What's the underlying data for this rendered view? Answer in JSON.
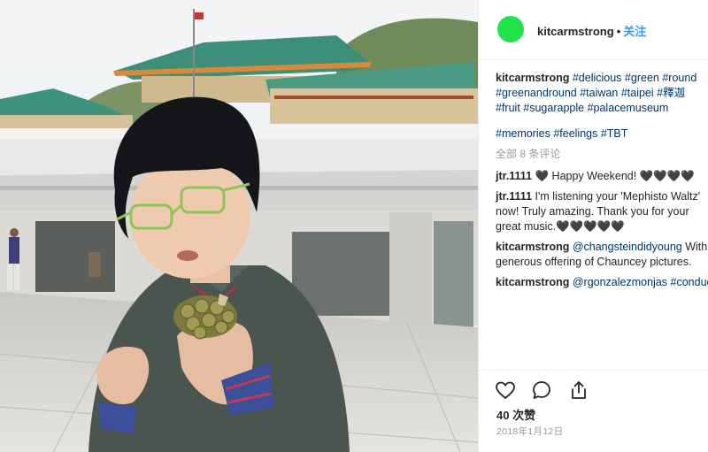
{
  "post": {
    "username": "kitcarmstrong",
    "follow_label": "关注",
    "separator": "•",
    "avatar_color": "#22e24a",
    "caption_user": "kitcarmstrong",
    "caption_tags": [
      "#delicious",
      "#green",
      "#round",
      "#greenandround",
      "#taiwan",
      "#taipei",
      "#釋迦",
      "#fruit",
      "#sugarapple",
      "#palacemuseum"
    ],
    "caption_tags_2": [
      "#memories",
      "#feelings",
      "#TBT"
    ],
    "view_all_comments": "全部 8 条评论",
    "comments": [
      {
        "user": "jtr.1111",
        "text": "🖤 Happy Weekend! 🖤🖤🖤🖤"
      },
      {
        "user": "jtr.1111",
        "text": "I'm listening your 'Mephisto Waltz' now! Truly amazing. Thank you for your great music.🖤🖤🖤🖤🖤"
      },
      {
        "user": "kitcarmstrong",
        "mention": "@changsteindidyoung",
        "text": "With generous offering of Chauncey pictures."
      },
      {
        "user": "kitcarmstrong",
        "mention": "@rgonzalezmonjas",
        "text": "#conducting"
      }
    ],
    "likes": "40 次赞",
    "date": "2018年1月12日"
  },
  "icons": {
    "like": "heart-icon",
    "comment": "comment-icon",
    "share": "share-icon"
  }
}
